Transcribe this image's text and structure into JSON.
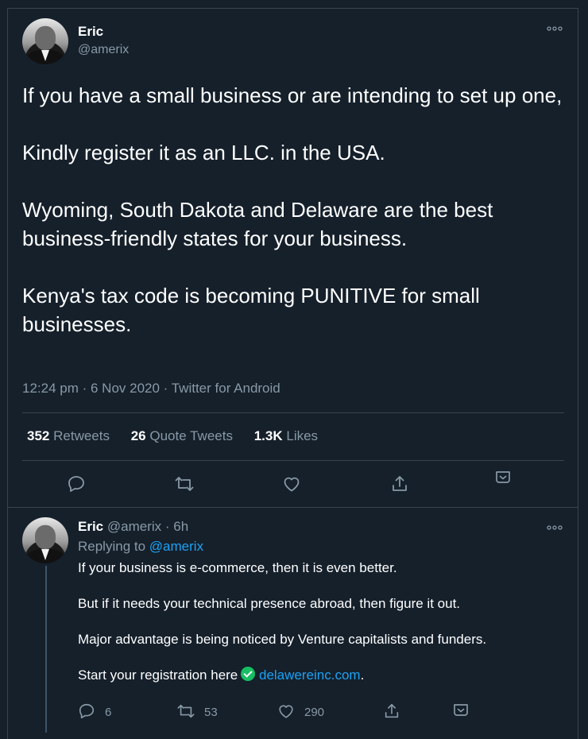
{
  "tweet": {
    "author_name": "Eric",
    "author_handle": "@amerix",
    "paragraphs": [
      "If you have a small business or are intending to set up one,",
      "Kindly register it as an LLC. in the USA.",
      "Wyoming, South Dakota and Delaware are the best business-friendly states for your business.",
      "Kenya's tax code is becoming PUNITIVE for small businesses."
    ],
    "meta": "12:24 pm · 6 Nov 2020 · Twitter for Android",
    "retweets_count": "352",
    "retweets_label": "Retweets",
    "quotes_count": "26",
    "quotes_label": "Quote Tweets",
    "likes_count": "1.3K",
    "likes_label": "Likes"
  },
  "reply": {
    "author_name": "Eric",
    "author_handle": "@amerix",
    "time": "· 6h",
    "replying_prefix": "Replying to",
    "replying_handle": "@amerix",
    "paragraphs": [
      "If your business is e-commerce, then it is even better.",
      "But if it needs your technical presence abroad, then figure it out.",
      "Major advantage is being noticed by Venture capitalists and funders."
    ],
    "last_line_prefix": "Start your registration here",
    "link_text": "delawereinc.com",
    "last_line_suffix": ".",
    "reply_count": "6",
    "retweet_count": "53",
    "like_count": "290"
  },
  "icons": {
    "more": "more-icon",
    "reply": "reply-icon",
    "retweet": "retweet-icon",
    "like": "like-icon",
    "share": "share-icon",
    "bookmark": "bookmark-icon",
    "check": "check-icon"
  },
  "colors": {
    "background": "#15202b",
    "muted": "#8899a6",
    "link": "#1da1f2",
    "divider": "#38444d",
    "check": "#17bf63"
  }
}
